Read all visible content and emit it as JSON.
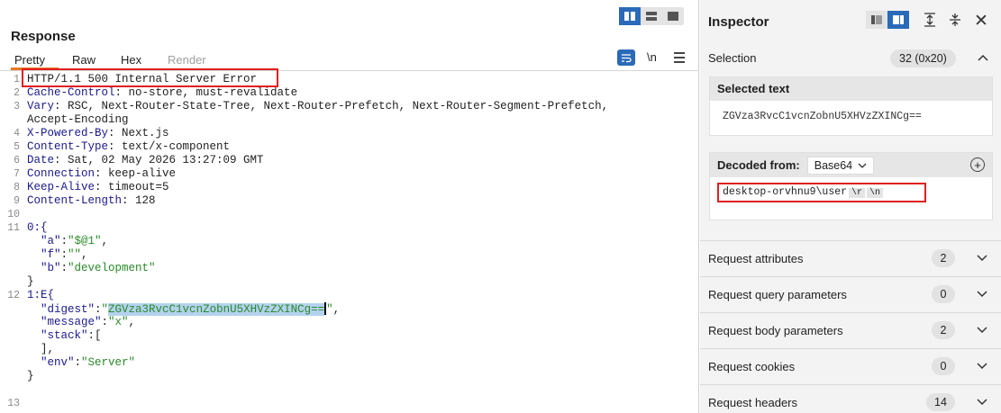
{
  "response": {
    "title": "Response",
    "tabs": {
      "pretty": "Pretty",
      "raw": "Raw",
      "hex": "Hex",
      "render": "Render"
    },
    "newline_label": "\\n",
    "lines": [
      {
        "n": "1",
        "parts": [
          {
            "t": "HTTP/1.1 500 Internal Server Error",
            "c": ""
          }
        ]
      },
      {
        "n": "2",
        "parts": [
          {
            "t": "Cache-Control",
            "c": "hk"
          },
          {
            "t": ": no-store, must-revalidate",
            "c": ""
          }
        ]
      },
      {
        "n": "3",
        "parts": [
          {
            "t": "Vary",
            "c": "hk"
          },
          {
            "t": ": RSC, Next-Router-State-Tree, Next-Router-Prefetch, Next-Router-Segment-Prefetch,",
            "c": ""
          }
        ]
      },
      {
        "n": "",
        "parts": [
          {
            "t": "Accept-Encoding",
            "c": ""
          }
        ]
      },
      {
        "n": "4",
        "parts": [
          {
            "t": "X-Powered-By",
            "c": "hk"
          },
          {
            "t": ": Next.js",
            "c": ""
          }
        ]
      },
      {
        "n": "5",
        "parts": [
          {
            "t": "Content-Type",
            "c": "hk"
          },
          {
            "t": ": text/x-component",
            "c": ""
          }
        ]
      },
      {
        "n": "6",
        "parts": [
          {
            "t": "Date",
            "c": "hk"
          },
          {
            "t": ": Sat, 02 May 2026 13:27:09 GMT",
            "c": ""
          }
        ]
      },
      {
        "n": "7",
        "parts": [
          {
            "t": "Connection",
            "c": "hk"
          },
          {
            "t": ": keep-alive",
            "c": ""
          }
        ]
      },
      {
        "n": "8",
        "parts": [
          {
            "t": "Keep-Alive",
            "c": "hk"
          },
          {
            "t": ": timeout=5",
            "c": ""
          }
        ]
      },
      {
        "n": "9",
        "parts": [
          {
            "t": "Content-Length",
            "c": "hk"
          },
          {
            "t": ": 128",
            "c": ""
          }
        ]
      },
      {
        "n": "10",
        "parts": []
      },
      {
        "n": "11",
        "parts": [
          {
            "t": "0:{",
            "c": "hk"
          }
        ]
      },
      {
        "n": "",
        "parts": [
          {
            "t": "  \"a\"",
            "c": "hk"
          },
          {
            "t": ":",
            "c": ""
          },
          {
            "t": "\"$@1\"",
            "c": "st"
          },
          {
            "t": ",",
            "c": ""
          }
        ]
      },
      {
        "n": "",
        "parts": [
          {
            "t": "  \"f\"",
            "c": "hk"
          },
          {
            "t": ":",
            "c": ""
          },
          {
            "t": "\"\"",
            "c": "st"
          },
          {
            "t": ",",
            "c": ""
          }
        ]
      },
      {
        "n": "",
        "parts": [
          {
            "t": "  \"b\"",
            "c": "hk"
          },
          {
            "t": ":",
            "c": ""
          },
          {
            "t": "\"development\"",
            "c": "st"
          }
        ]
      },
      {
        "n": "",
        "parts": [
          {
            "t": "}",
            "c": ""
          }
        ]
      },
      {
        "n": "12",
        "parts": [
          {
            "t": "1:E{",
            "c": "hk"
          }
        ]
      },
      {
        "n": "",
        "parts": [
          {
            "t": "  \"digest\"",
            "c": "hk"
          },
          {
            "t": ":",
            "c": ""
          },
          {
            "t": "\"",
            "c": "st"
          },
          {
            "t": "ZGVza3RvcC1vcnZobnU5XHVzZXINCg==",
            "c": "st sel"
          },
          {
            "t": "CARET",
            "c": "caret"
          },
          {
            "t": "\"",
            "c": "st"
          },
          {
            "t": ",",
            "c": ""
          }
        ]
      },
      {
        "n": "",
        "parts": [
          {
            "t": "  \"message\"",
            "c": "hk"
          },
          {
            "t": ":",
            "c": ""
          },
          {
            "t": "\"x\"",
            "c": "st"
          },
          {
            "t": ",",
            "c": ""
          }
        ]
      },
      {
        "n": "",
        "parts": [
          {
            "t": "  \"stack\"",
            "c": "hk"
          },
          {
            "t": ":[",
            "c": ""
          }
        ]
      },
      {
        "n": "",
        "parts": [
          {
            "t": "  ],",
            "c": ""
          }
        ]
      },
      {
        "n": "",
        "parts": [
          {
            "t": "  \"env\"",
            "c": "hk"
          },
          {
            "t": ":",
            "c": ""
          },
          {
            "t": "\"Server\"",
            "c": "st"
          }
        ]
      },
      {
        "n": "",
        "parts": [
          {
            "t": "}",
            "c": ""
          }
        ]
      },
      {
        "n": "",
        "parts": []
      },
      {
        "n": "13",
        "parts": []
      }
    ]
  },
  "inspector": {
    "title": "Inspector",
    "selection": {
      "label": "Selection",
      "badge": "32 (0x20)"
    },
    "selected_text": {
      "title": "Selected text",
      "value": "ZGVza3RvcC1vcnZobnU5XHVzZXINCg=="
    },
    "decoded": {
      "label": "Decoded from:",
      "encoding": "Base64",
      "value": "desktop-orvhnu9\\user",
      "esc1": "\\r",
      "esc2": "\\n"
    },
    "sections": [
      {
        "label": "Request attributes",
        "count": "2"
      },
      {
        "label": "Request query parameters",
        "count": "0"
      },
      {
        "label": "Request body parameters",
        "count": "2"
      },
      {
        "label": "Request cookies",
        "count": "0"
      },
      {
        "label": "Request headers",
        "count": "14"
      }
    ]
  },
  "colors": {
    "accent": "#2a6ab8",
    "tab_underline": "#e87722",
    "highlight_box": "#e02020",
    "header_key": "#1a1a8c",
    "string_value": "#2a8a2a"
  }
}
